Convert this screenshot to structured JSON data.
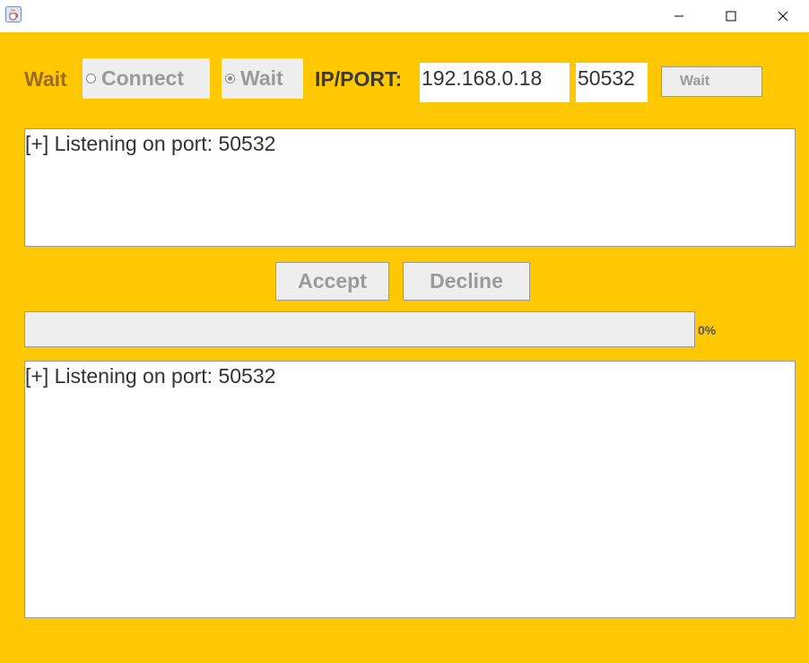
{
  "titlebar": {
    "app_icon": "java-coffee-icon",
    "controls": [
      "minimize-icon",
      "maximize-icon",
      "close-icon"
    ]
  },
  "mode": {
    "label": "Wait",
    "options": [
      {
        "label": "Connect",
        "selected": false
      },
      {
        "label": "Wait",
        "selected": true
      }
    ]
  },
  "connection": {
    "label": "IP/PORT:",
    "ip": "192.168.0.18",
    "port": "50532",
    "action_label": "Wait"
  },
  "messages_log": {
    "lines": [
      "[+] Listening on port: 50532"
    ]
  },
  "transfer": {
    "accept_label": "Accept",
    "decline_label": "Decline",
    "progress_fraction": 0,
    "progress_text": "0%"
  },
  "status_log": {
    "lines": [
      "[+] Listening on port: 50532"
    ]
  },
  "colors": {
    "background": "#ffc800",
    "mode_label": "#9c6a2a",
    "disabled_text": "#9a9a9a"
  }
}
